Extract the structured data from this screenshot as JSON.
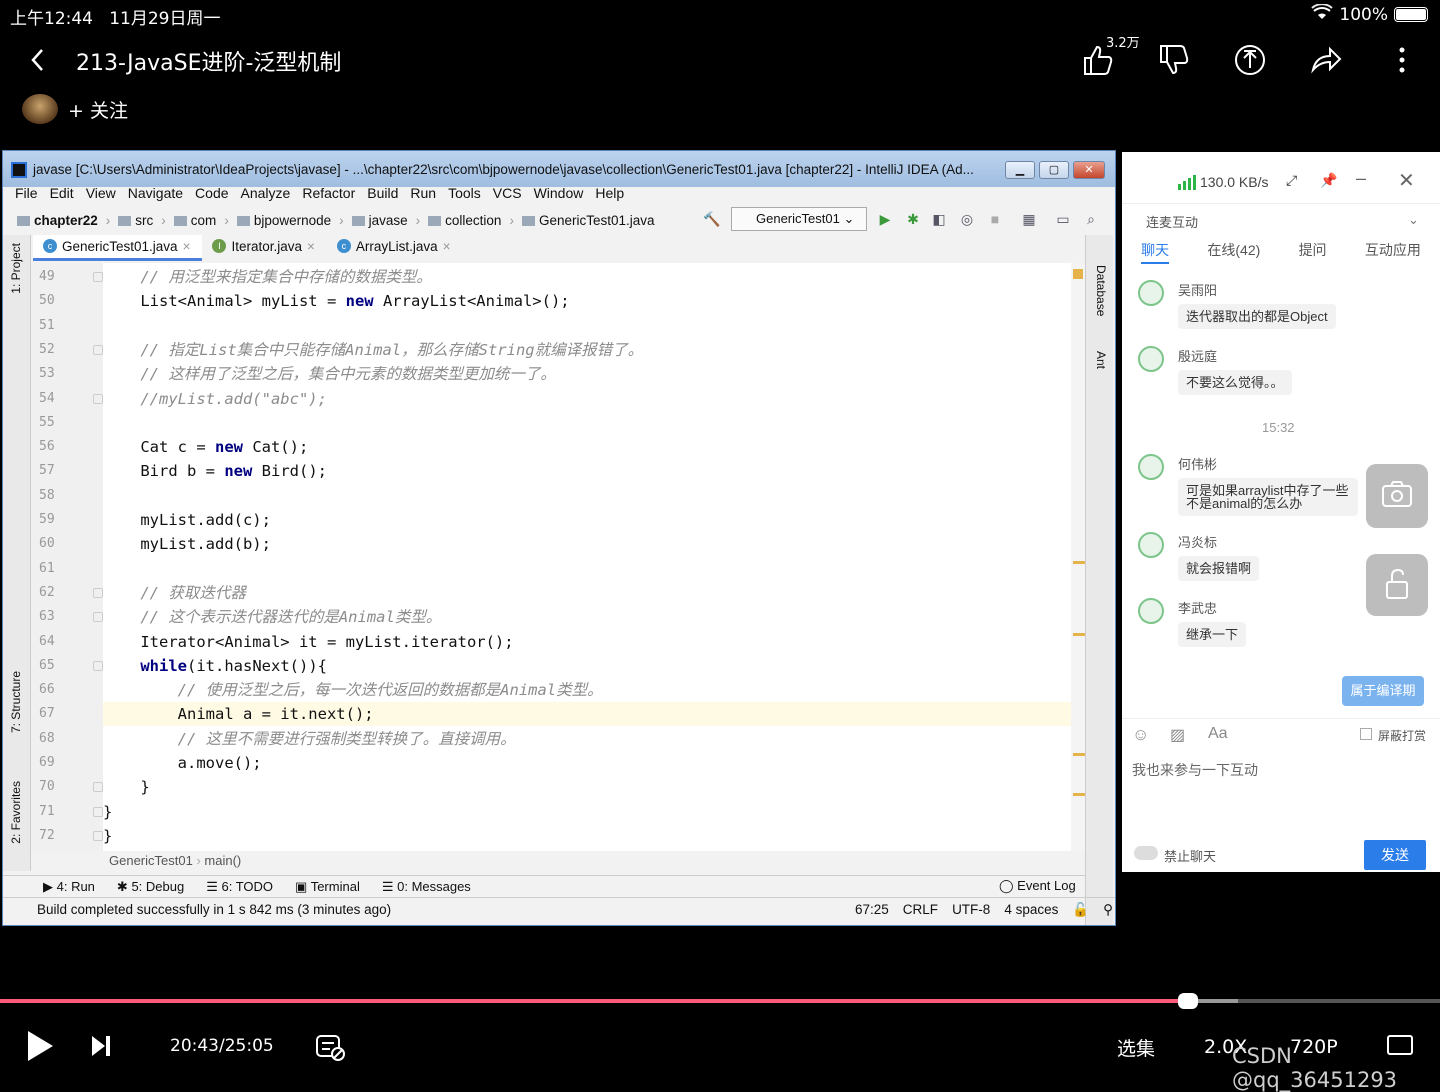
{
  "status_bar": {
    "time": "上午12:44",
    "date": "11月29日周一",
    "battery": "100%",
    "battery_level": 1.0
  },
  "video_header": {
    "title": "213-JavaSE进阶-泛型机制",
    "like_count": "3.2万",
    "follow_label": "+ 关注"
  },
  "ide": {
    "window_title": "javase [C:\\Users\\Administrator\\IdeaProjects\\javase] - ...\\chapter22\\src\\com\\bjpowernode\\javase\\collection\\GenericTest01.java [chapter22] - IntelliJ IDEA (Ad...",
    "menu": [
      "File",
      "Edit",
      "View",
      "Navigate",
      "Code",
      "Analyze",
      "Refactor",
      "Build",
      "Run",
      "Tools",
      "VCS",
      "Window",
      "Help"
    ],
    "breadcrumb": [
      "chapter22",
      "src",
      "com",
      "bjpowernode",
      "javase",
      "collection",
      "GenericTest01.java"
    ],
    "run_config": "GenericTest01",
    "tabs": [
      "GenericTest01.java",
      "Iterator.java",
      "ArrayList.java"
    ],
    "left_tools": [
      "1: Project",
      "7: Structure",
      "2: Favorites"
    ],
    "right_tools": [
      "Database",
      "Ant"
    ],
    "lines": [
      {
        "n": "49",
        "text": "    // 用泛型来指定集合中存储的数据类型。"
      },
      {
        "n": "50",
        "text": "    List<Animal> myList = new ArrayList<Animal>();"
      },
      {
        "n": "51",
        "text": ""
      },
      {
        "n": "52",
        "text": "    // 指定List集合中只能存储Animal，那么存储String就编译报错了。"
      },
      {
        "n": "53",
        "text": "    // 这样用了泛型之后，集合中元素的数据类型更加统一了。"
      },
      {
        "n": "54",
        "text": "    //myList.add(\"abc\");"
      },
      {
        "n": "55",
        "text": ""
      },
      {
        "n": "56",
        "text": "    Cat c = new Cat();"
      },
      {
        "n": "57",
        "text": "    Bird b = new Bird();"
      },
      {
        "n": "58",
        "text": ""
      },
      {
        "n": "59",
        "text": "    myList.add(c);"
      },
      {
        "n": "60",
        "text": "    myList.add(b);"
      },
      {
        "n": "61",
        "text": ""
      },
      {
        "n": "62",
        "text": "    // 获取迭代器"
      },
      {
        "n": "63",
        "text": "    // 这个表示迭代器迭代的是Animal类型。"
      },
      {
        "n": "64",
        "text": "    Iterator<Animal> it = myList.iterator();"
      },
      {
        "n": "65",
        "text": "    while(it.hasNext()){"
      },
      {
        "n": "66",
        "text": "        // 使用泛型之后，每一次迭代返回的数据都是Animal类型。"
      },
      {
        "n": "67",
        "text": "        Animal a = it.next();"
      },
      {
        "n": "68",
        "text": "        // 这里不需要进行强制类型转换了。直接调用。"
      },
      {
        "n": "69",
        "text": "        a.move();"
      },
      {
        "n": "70",
        "text": "    }"
      },
      {
        "n": "71",
        "text": "}"
      },
      {
        "n": "72",
        "text": "}"
      }
    ],
    "code_breadcrumb": [
      "GenericTest01",
      "main()"
    ],
    "bottom_tools": [
      "4: Run",
      "5: Debug",
      "6: TODO",
      "Terminal",
      "0: Messages"
    ],
    "event_log": "Event Log",
    "status_message": "Build completed successfully in 1 s 842 ms (3 minutes ago)",
    "position": "67:25",
    "line_sep": "CRLF",
    "encoding": "UTF-8",
    "indent": "4 spaces"
  },
  "chat": {
    "speed": "130.0 KB/s",
    "section": "连麦互动",
    "tabs": [
      "聊天",
      "在线(42)",
      "提问",
      "互动应用"
    ],
    "messages": [
      {
        "name": "吴雨阳",
        "text": "迭代器取出的都是Object"
      },
      {
        "name": "殷远庭",
        "text": "不要这么觉得。。"
      },
      {
        "name": "何伟彬",
        "text": "可是如果arraylist中存了一些不是animal的怎么办"
      },
      {
        "name": "冯炎标",
        "text": "就会报错啊"
      },
      {
        "name": "李武忠",
        "text": "继承一下"
      }
    ],
    "time_divider": "15:32",
    "quiz_button": "属于编译期",
    "block_label": "屏蔽打赏",
    "input_placeholder": "我也来参与一下互动",
    "mute_label": "禁止聊天",
    "send_label": "发送"
  },
  "player": {
    "time": "20:43/25:05",
    "progress": 0.825,
    "buffered": 0.86,
    "episodes": "选集",
    "speed": "2.0X",
    "quality": "720P",
    "watermark": "CSDN @qq_36451293"
  }
}
